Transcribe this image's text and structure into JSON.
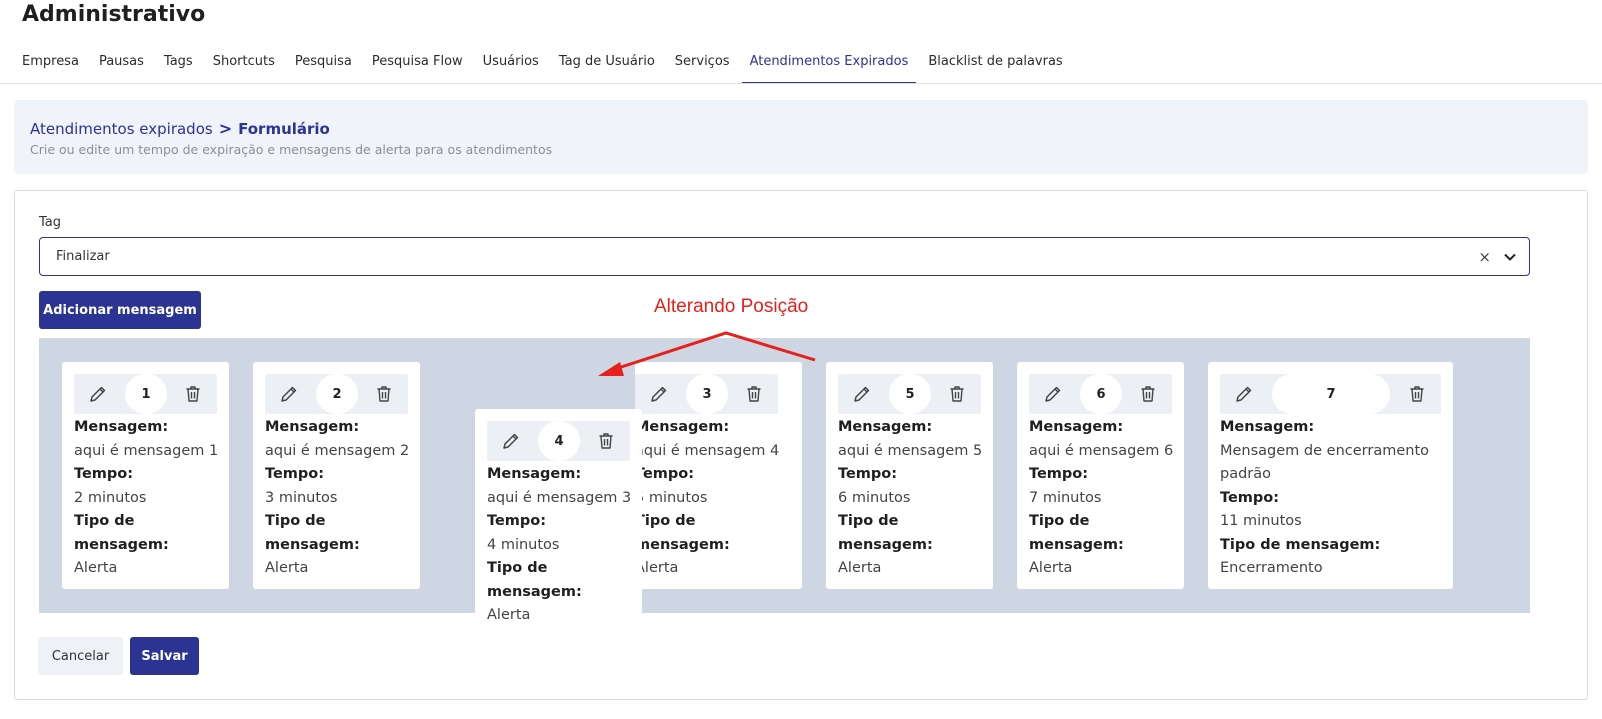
{
  "page": {
    "title": "Administrativo"
  },
  "tabs": [
    {
      "label": "Empresa",
      "active": false
    },
    {
      "label": "Pausas",
      "active": false
    },
    {
      "label": "Tags",
      "active": false
    },
    {
      "label": "Shortcuts",
      "active": false
    },
    {
      "label": "Pesquisa",
      "active": false
    },
    {
      "label": "Pesquisa Flow",
      "active": false
    },
    {
      "label": "Usuários",
      "active": false
    },
    {
      "label": "Tag de Usuário",
      "active": false
    },
    {
      "label": "Serviços",
      "active": false
    },
    {
      "label": "Atendimentos Expirados",
      "active": true
    },
    {
      "label": "Blacklist de palavras",
      "active": false
    }
  ],
  "breadcrumb": {
    "parent": "Atendimentos expirados",
    "separator": ">",
    "current": "Formulário"
  },
  "subtitle": "Crie ou edite um tempo de expiração e mensagens de alerta para os atendimentos",
  "form": {
    "tag_label": "Tag",
    "tag_value": "Finalizar",
    "clear_icon": "×",
    "add_button": "Adicionar mensagem",
    "cancel_button": "Cancelar",
    "save_button": "Salvar"
  },
  "labels": {
    "mensagem": "Mensagem:",
    "tempo": "Tempo:",
    "tipo": "Tipo de mensagem:"
  },
  "cards": [
    {
      "number": "1",
      "mensagem": "aqui é mensagem 1",
      "tempo": "2 minutos",
      "tipo": "Alerta"
    },
    {
      "number": "2",
      "mensagem": "aqui é mensagem 2",
      "tempo": "3 minutos",
      "tipo": "Alerta"
    },
    {
      "number": "4",
      "mensagem": "aqui é mensagem 3",
      "tempo": "4 minutos",
      "tipo": "Alerta",
      "dragging": true
    },
    {
      "number": "3",
      "mensagem": "aqui é mensagem 4",
      "tempo": "5 minutos",
      "tipo": "Alerta"
    },
    {
      "number": "5",
      "mensagem": "aqui é mensagem 5",
      "tempo": "6 minutos",
      "tipo": "Alerta"
    },
    {
      "number": "6",
      "mensagem": "aqui é mensagem 6",
      "tempo": "7 minutos",
      "tipo": "Alerta"
    },
    {
      "number": "7",
      "mensagem": "Mensagem de encerramento padrão",
      "tempo": "11 minutos",
      "tipo": "Encerramento"
    }
  ],
  "annotation": {
    "text": "Alterando Posição",
    "color": "#e6201b"
  },
  "colors": {
    "accent": "#2b3493",
    "cards_background": "#cdd6e2",
    "header_background": "#f0f3f8"
  },
  "icons": {
    "edit": "pencil-icon",
    "delete": "trash-icon",
    "dropdown": "chevron-down-icon",
    "clear": "close-icon"
  }
}
